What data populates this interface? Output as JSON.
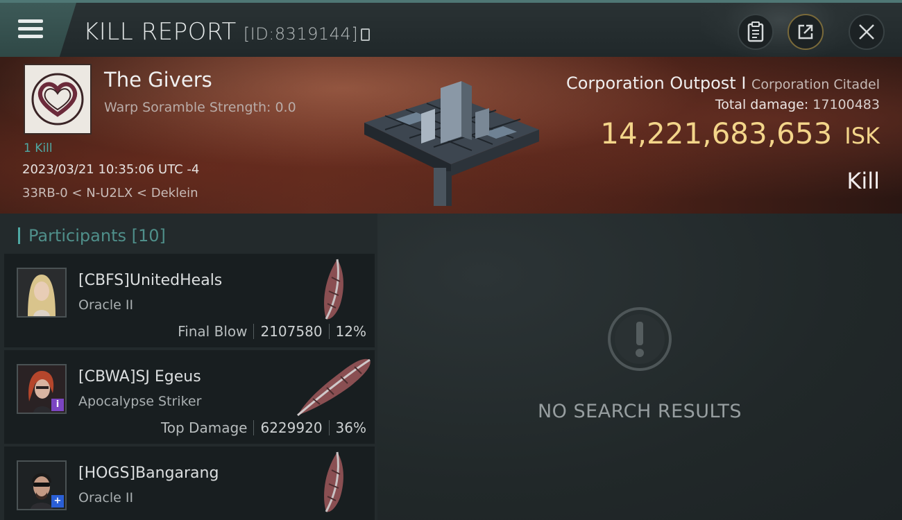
{
  "header": {
    "title": "KILL REPORT",
    "report_id": "[ID:8319144]"
  },
  "victim": {
    "name": "The Givers",
    "scramble": "Warp Soramble Strength: 0.0",
    "kill_count": "1 Kill",
    "datetime": "2023/03/21 10:35:06 UTC -4",
    "location": "33RB-0 < N-U2LX < Deklein"
  },
  "target": {
    "name": "Corporation Outpost I",
    "type": "Corporation Citadel",
    "damage_label": "Total damage:",
    "damage_value": "17100483",
    "isk_value": "14,221,683,653",
    "isk_unit": "ISK",
    "result": "Kill"
  },
  "participants": {
    "label": "Participants",
    "count": "[10]",
    "items": [
      {
        "name": "[CBFS]UnitedHeals",
        "ship": "Oracle II",
        "role": "Final Blow",
        "damage": "2107580",
        "percent": "12%"
      },
      {
        "name": "[CBWA]SJ Egeus",
        "ship": "Apocalypse Striker",
        "role": "Top Damage",
        "damage": "6229920",
        "percent": "36%"
      },
      {
        "name": "[HOGS]Bangarang",
        "ship": "Oracle II"
      }
    ]
  },
  "empty_state": {
    "message": "NO SEARCH RESULTS"
  },
  "colors": {
    "accent_teal": "#4fa9a4",
    "isk_gold": "#f3d58a",
    "banner_red": "#5a2a1f"
  }
}
